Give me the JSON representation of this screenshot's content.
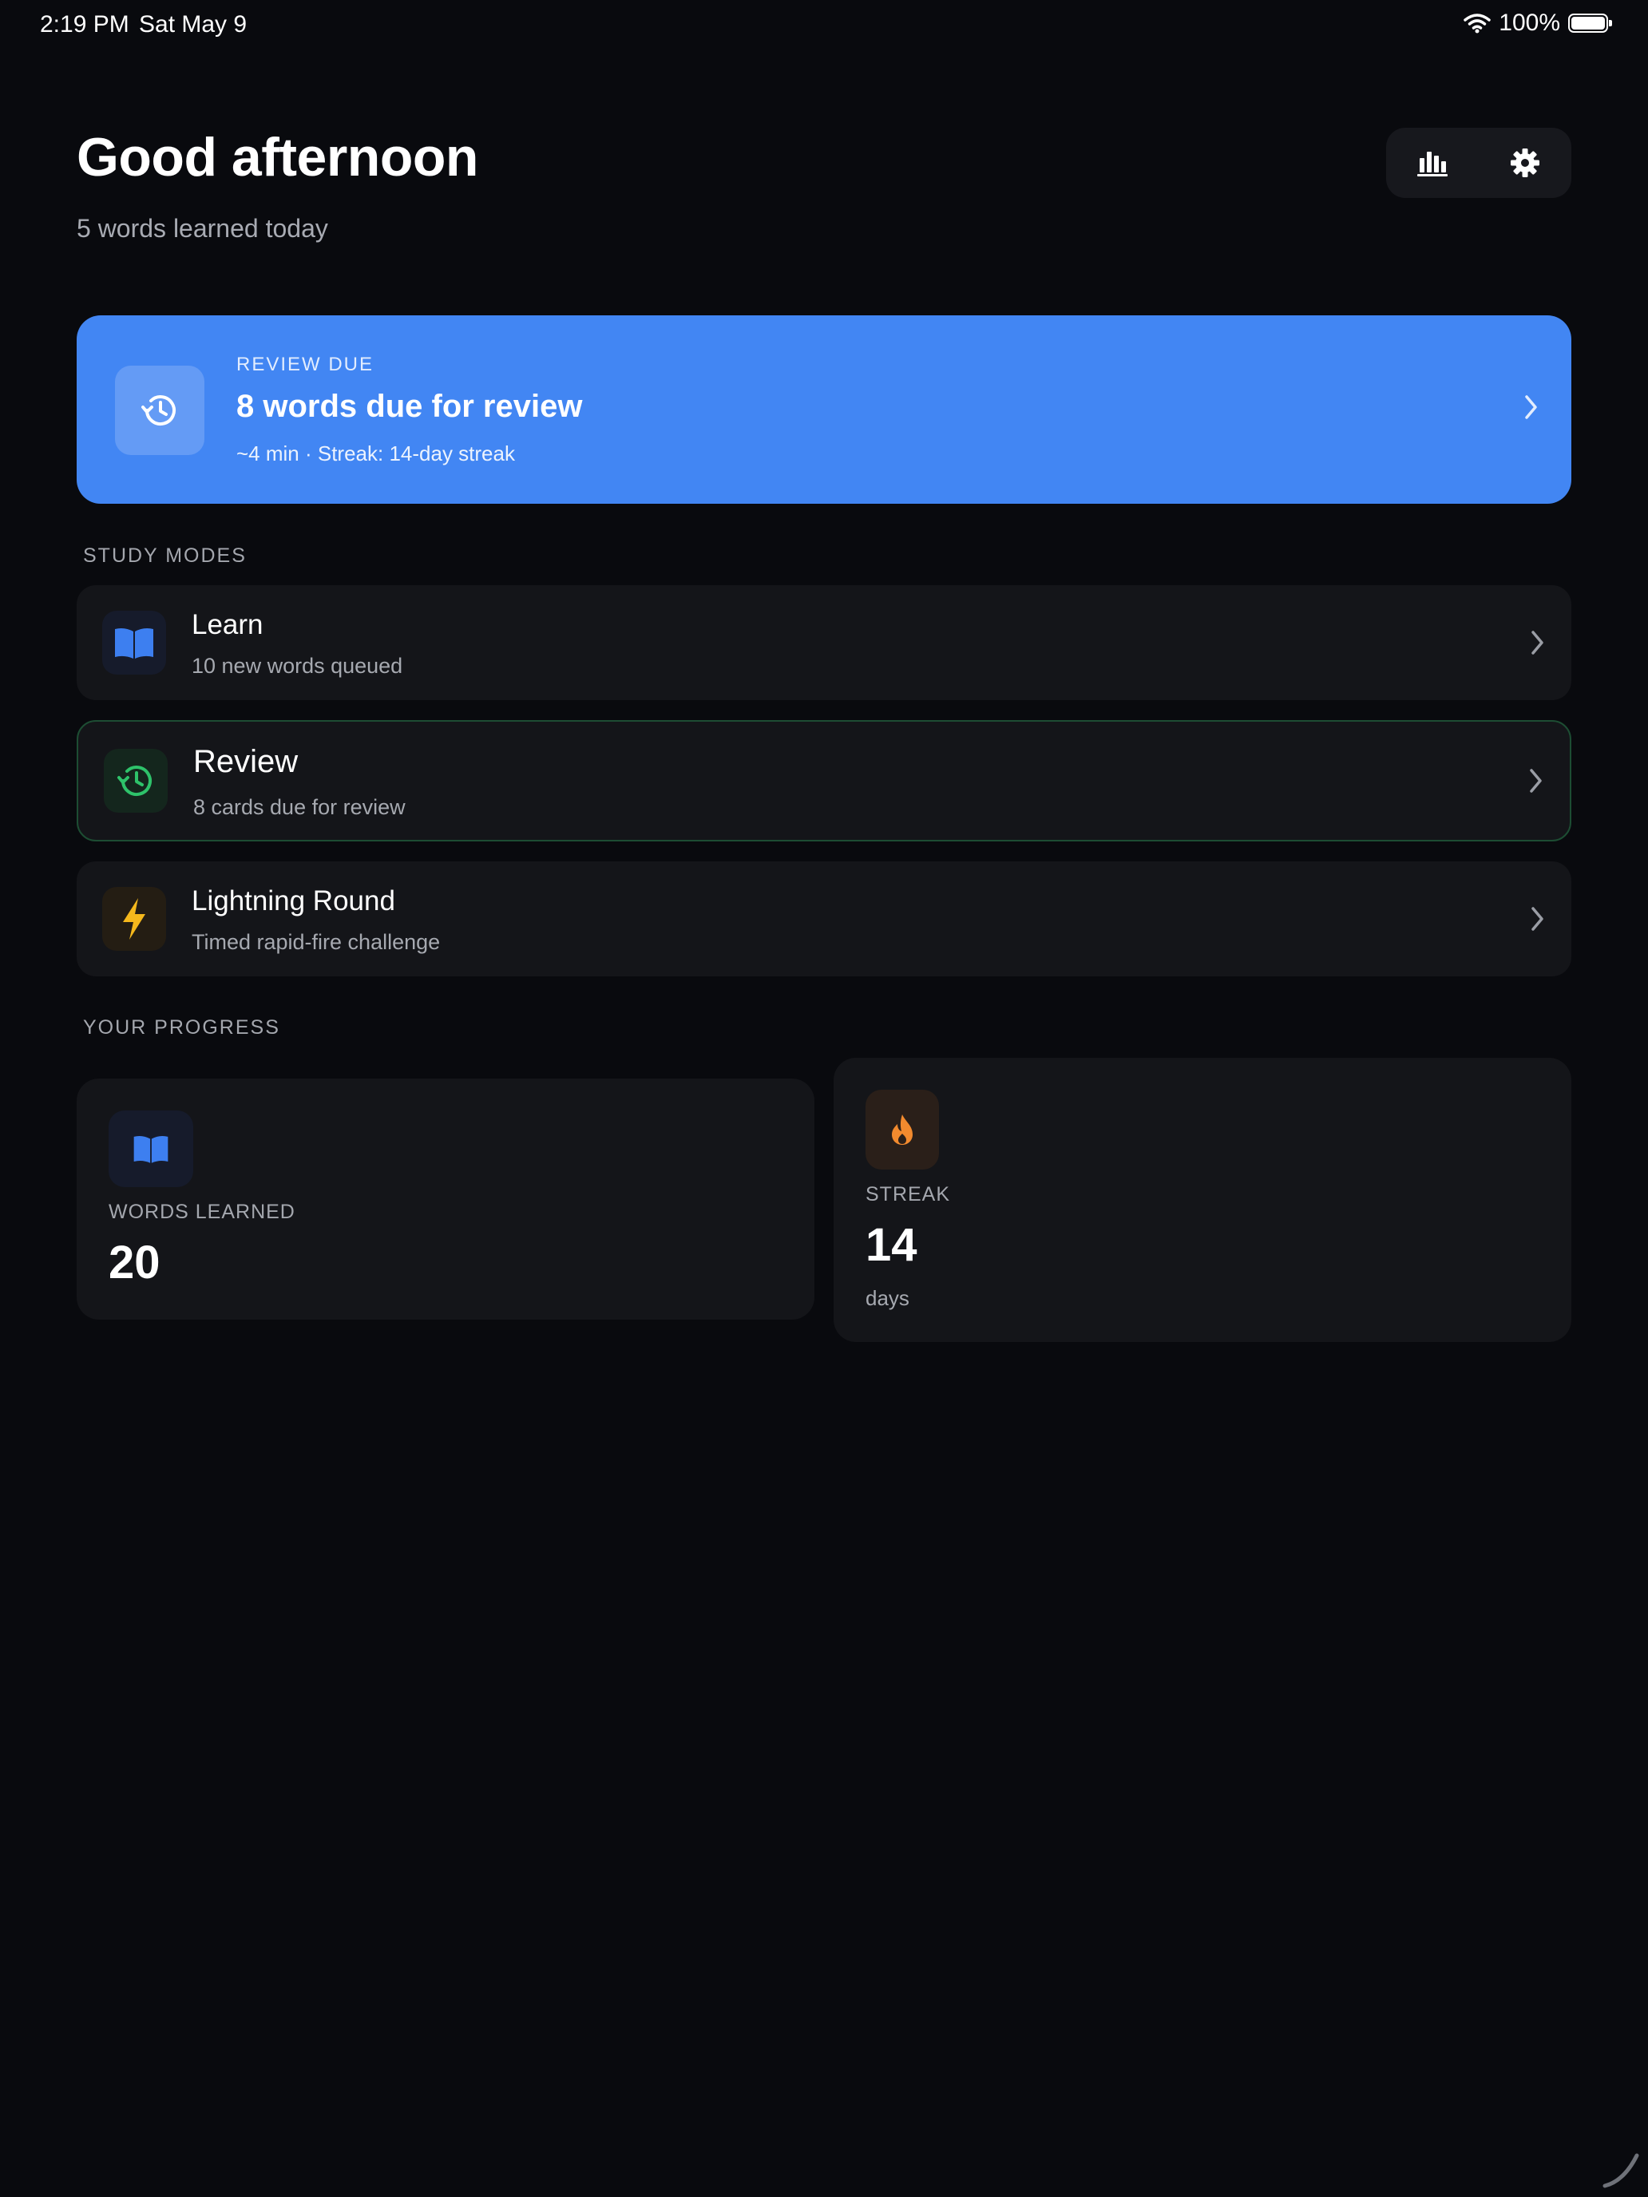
{
  "status_bar": {
    "time": "2:19 PM",
    "date": "Sat May 9",
    "battery": "100%"
  },
  "header": {
    "greeting": "Good afternoon",
    "subtitle": "5 words learned today"
  },
  "toolbar": {
    "stats_icon": "bar-chart-icon",
    "settings_icon": "gear-icon"
  },
  "review_banner": {
    "eyebrow": "REVIEW DUE",
    "title": "8 words due for review",
    "meta": "~4 min · Streak: 14-day streak",
    "icon": "history-icon",
    "color": "#4286f3"
  },
  "study_modes": {
    "label": "STUDY MODES",
    "items": [
      {
        "title": "Learn",
        "subtitle": "10 new words queued",
        "icon": "book-icon",
        "color": "#3d7ff0"
      },
      {
        "title": "Review",
        "subtitle": "8 cards due for review",
        "icon": "history-icon",
        "color": "#2ec26a"
      },
      {
        "title": "Lightning Round",
        "subtitle": "Timed rapid-fire challenge",
        "icon": "lightning-icon",
        "color": "#f5b81c"
      }
    ]
  },
  "progress": {
    "label": "YOUR PROGRESS",
    "words_learned": {
      "label": "WORDS LEARNED",
      "value": "20",
      "icon": "book-icon"
    },
    "streak": {
      "label": "STREAK",
      "value": "14",
      "unit": "days",
      "icon": "flame-icon",
      "color": "#f28a2e"
    }
  }
}
